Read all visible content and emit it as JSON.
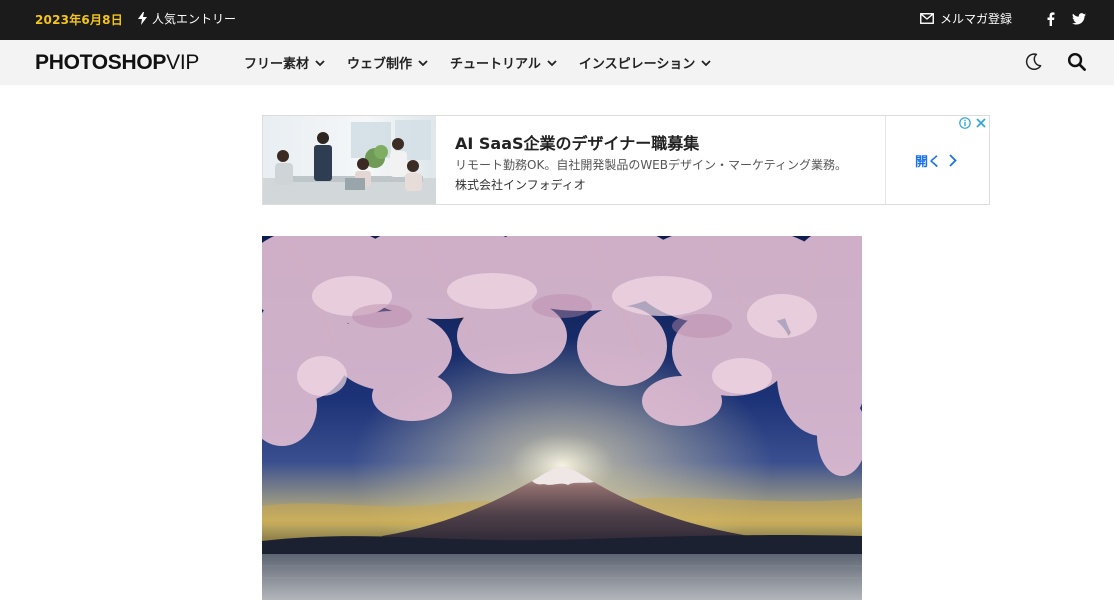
{
  "topbar": {
    "date": "2023年6月8日",
    "popular": "人気エントリー",
    "newsletter": "メルマガ登録",
    "icons": [
      "bolt-icon",
      "mail-icon",
      "facebook-icon",
      "twitter-icon"
    ]
  },
  "header": {
    "logo_main": "PHOTOSHOP",
    "logo_suffix": "VIP",
    "menu": [
      {
        "label": "フリー素材"
      },
      {
        "label": "ウェブ制作"
      },
      {
        "label": "チュートリアル"
      },
      {
        "label": "インスピレーション"
      }
    ],
    "icons": [
      "moon-icon",
      "search-icon"
    ]
  },
  "ad": {
    "title": "AI SaaS企業のデザイナー職募集",
    "description": "リモート勤務OK。自社開発製品のWEBデザイン・マーケティング業務。",
    "company": "株式会社インフォディオ",
    "cta": "開く",
    "icons": [
      "info-icon",
      "close-icon",
      "chevron-right-icon"
    ]
  },
  "colors": {
    "topbar_bg": "#1b1b1b",
    "date": "#f5c518",
    "navbar_bg": "#f3f3f3",
    "ad_link": "#1a73e8"
  }
}
